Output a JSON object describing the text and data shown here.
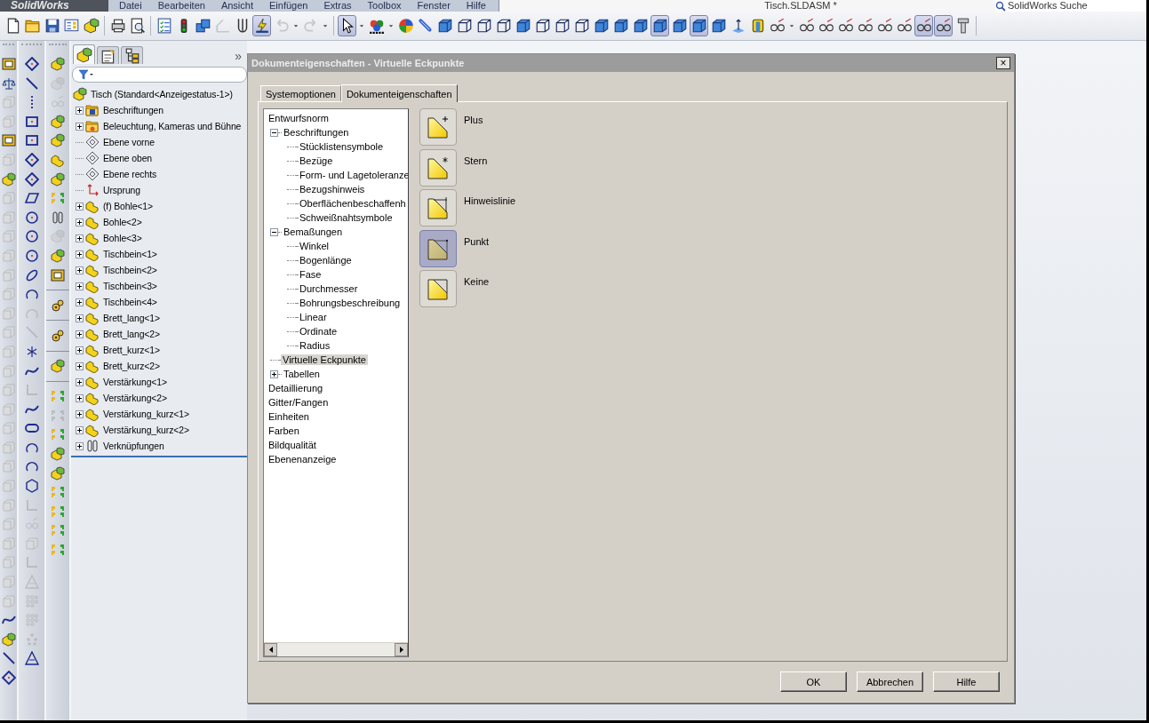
{
  "app": {
    "logo": "SolidWorks",
    "menu": [
      "Datei",
      "Bearbeiten",
      "Ansicht",
      "Einfügen",
      "Extras",
      "Toolbox",
      "Fenster",
      "Hilfe"
    ],
    "document_title": "Tisch.SLDASM *",
    "search": {
      "placeholder": "SolidWorks Suche"
    }
  },
  "toolbar": [
    {
      "kind": "doc",
      "selected": false,
      "disabled": false
    },
    {
      "kind": "folder",
      "selected": false,
      "disabled": false
    },
    {
      "kind": "disk",
      "selected": false,
      "disabled": false
    },
    {
      "kind": "sheet",
      "selected": false,
      "disabled": false
    },
    {
      "kind": "blocks",
      "selected": false,
      "disabled": false
    },
    {
      "kind": "separator"
    },
    {
      "kind": "printer",
      "selected": false,
      "disabled": false
    },
    {
      "kind": "preview",
      "selected": false,
      "disabled": false
    },
    {
      "kind": "separator"
    },
    {
      "kind": "list",
      "selected": false,
      "disabled": false
    },
    {
      "kind": "light",
      "selected": false,
      "disabled": false
    },
    {
      "kind": "cubes",
      "selected": false,
      "disabled": false
    },
    {
      "kind": "sketch",
      "selected": false,
      "disabled": true
    },
    {
      "kind": "pen",
      "selected": false,
      "disabled": false
    },
    {
      "kind": "rebuild",
      "selected": true,
      "disabled": false
    },
    {
      "kind": "undo",
      "selected": false,
      "disabled": true
    },
    {
      "kind": "caret",
      "selected": false,
      "disabled": false
    },
    {
      "kind": "redo",
      "selected": false,
      "disabled": true
    },
    {
      "kind": "caret",
      "selected": false,
      "disabled": false
    },
    {
      "kind": "separator"
    },
    {
      "kind": "arrow",
      "selected": true,
      "disabled": false
    },
    {
      "kind": "caret",
      "selected": false,
      "disabled": false
    },
    {
      "kind": "spheres",
      "selected": false,
      "disabled": false
    },
    {
      "kind": "caret",
      "selected": false,
      "disabled": false
    },
    {
      "kind": "ball",
      "selected": false,
      "disabled": false
    },
    {
      "kind": "pin",
      "selected": false,
      "disabled": false
    },
    {
      "kind": "cube",
      "selected": false,
      "disabled": false
    },
    {
      "kind": "wirecube",
      "selected": false,
      "disabled": false
    },
    {
      "kind": "wirecube",
      "selected": false,
      "disabled": false
    },
    {
      "kind": "wirecube",
      "selected": false,
      "disabled": false
    },
    {
      "kind": "cube",
      "selected": false,
      "disabled": false
    },
    {
      "kind": "wirecube",
      "selected": false,
      "disabled": false
    },
    {
      "kind": "wirecube",
      "selected": false,
      "disabled": false
    },
    {
      "kind": "wirecube",
      "selected": false,
      "disabled": false
    },
    {
      "kind": "cube",
      "selected": false,
      "disabled": false
    },
    {
      "kind": "cube",
      "selected": false,
      "disabled": false
    },
    {
      "kind": "cube",
      "selected": false,
      "disabled": false
    },
    {
      "kind": "cube",
      "selected": true,
      "disabled": false
    },
    {
      "kind": "cube",
      "selected": false,
      "disabled": false
    },
    {
      "kind": "cube",
      "selected": true,
      "disabled": false
    },
    {
      "kind": "cube",
      "selected": false,
      "disabled": false
    },
    {
      "kind": "axis",
      "selected": false,
      "disabled": false
    },
    {
      "kind": "cylinder",
      "selected": false,
      "disabled": false
    },
    {
      "kind": "glasses",
      "selected": false,
      "disabled": false
    },
    {
      "kind": "caret",
      "selected": false,
      "disabled": false
    },
    {
      "kind": "glasses",
      "selected": false,
      "disabled": false
    },
    {
      "kind": "glasses",
      "selected": false,
      "disabled": false
    },
    {
      "kind": "glasses",
      "selected": false,
      "disabled": false
    },
    {
      "kind": "glasses",
      "selected": false,
      "disabled": false
    },
    {
      "kind": "glasses",
      "selected": false,
      "disabled": false
    },
    {
      "kind": "glasses",
      "selected": false,
      "disabled": false
    },
    {
      "kind": "glasses",
      "selected": true,
      "disabled": false
    },
    {
      "kind": "glasses",
      "selected": true,
      "disabled": false
    },
    {
      "kind": "bolt",
      "selected": false,
      "disabled": false
    },
    {
      "kind": "separator"
    }
  ],
  "side_toolbars": [
    [
      {
        "kind": "window",
        "disabled": false
      },
      {
        "kind": "scale",
        "disabled": false
      },
      {
        "kind": "box",
        "disabled": true
      },
      {
        "kind": "box",
        "disabled": true
      },
      {
        "kind": "window",
        "disabled": false
      },
      {
        "kind": "box",
        "disabled": true
      },
      {
        "kind": "blocks",
        "disabled": false
      },
      {
        "kind": "box",
        "disabled": true
      },
      {
        "kind": "box",
        "disabled": true
      },
      {
        "kind": "box",
        "disabled": true
      },
      {
        "kind": "box",
        "disabled": true
      },
      {
        "kind": "box",
        "disabled": true
      },
      {
        "kind": "box",
        "disabled": true
      },
      {
        "kind": "box",
        "disabled": true
      },
      {
        "kind": "box",
        "disabled": true
      },
      {
        "kind": "box",
        "disabled": true
      },
      {
        "kind": "box",
        "disabled": true
      },
      {
        "kind": "box",
        "disabled": true
      },
      {
        "kind": "box",
        "disabled": true
      },
      {
        "kind": "box",
        "disabled": true
      },
      {
        "kind": "box",
        "disabled": true
      },
      {
        "kind": "box",
        "disabled": true
      },
      {
        "kind": "box",
        "disabled": true
      },
      {
        "kind": "box",
        "disabled": true
      },
      {
        "kind": "box",
        "disabled": true
      },
      {
        "kind": "box",
        "disabled": true
      },
      {
        "kind": "box",
        "disabled": true
      },
      {
        "kind": "box",
        "disabled": true
      },
      {
        "kind": "box",
        "disabled": true
      },
      {
        "kind": "curve",
        "disabled": false
      },
      {
        "kind": "blocks",
        "disabled": false
      },
      {
        "kind": "line",
        "disabled": false
      },
      {
        "kind": "diamond",
        "disabled": false
      }
    ],
    [
      {
        "kind": "diamond",
        "disabled": false
      },
      {
        "kind": "line",
        "disabled": false
      },
      {
        "kind": "dotline",
        "disabled": false
      },
      {
        "kind": "rect",
        "disabled": false
      },
      {
        "kind": "rect",
        "disabled": false
      },
      {
        "kind": "diamond",
        "disabled": false
      },
      {
        "kind": "diamond",
        "disabled": false
      },
      {
        "kind": "parallelogram",
        "disabled": false
      },
      {
        "kind": "circle",
        "disabled": false
      },
      {
        "kind": "circle",
        "disabled": false
      },
      {
        "kind": "circle",
        "disabled": false
      },
      {
        "kind": "ellipse",
        "disabled": false
      },
      {
        "kind": "arc",
        "disabled": false
      },
      {
        "kind": "arc",
        "disabled": true
      },
      {
        "kind": "line",
        "disabled": true
      },
      {
        "kind": "point",
        "disabled": false
      },
      {
        "kind": "curve",
        "disabled": false
      },
      {
        "kind": "corner",
        "disabled": true
      },
      {
        "kind": "curve",
        "disabled": false
      },
      {
        "kind": "slot",
        "disabled": false
      },
      {
        "kind": "arc",
        "disabled": false
      },
      {
        "kind": "arc",
        "disabled": false
      },
      {
        "kind": "hexagon",
        "disabled": false
      },
      {
        "kind": "corner",
        "disabled": true
      },
      {
        "kind": "glasses",
        "disabled": true
      },
      {
        "kind": "box",
        "disabled": true
      },
      {
        "kind": "corner",
        "disabled": true
      },
      {
        "kind": "triangle",
        "disabled": true
      },
      {
        "kind": "grid",
        "disabled": true
      },
      {
        "kind": "grid",
        "disabled": true
      },
      {
        "kind": "dots",
        "disabled": true
      },
      {
        "kind": "triangle",
        "disabled": false
      }
    ],
    [
      {
        "kind": "blocks",
        "disabled": false
      },
      {
        "kind": "blocks",
        "disabled": true
      },
      {
        "kind": "glasses",
        "disabled": true
      },
      {
        "kind": "blocks",
        "disabled": false
      },
      {
        "kind": "blocks",
        "disabled": false
      },
      {
        "kind": "part",
        "disabled": false
      },
      {
        "kind": "blocks",
        "disabled": false
      },
      {
        "kind": "mate",
        "disabled": false
      },
      {
        "kind": "clip",
        "disabled": false
      },
      {
        "kind": "blocks",
        "disabled": true
      },
      {
        "kind": "blocks",
        "disabled": false
      },
      {
        "kind": "window",
        "disabled": false
      },
      {
        "kind": "separator"
      },
      {
        "kind": "gear",
        "disabled": false
      },
      {
        "kind": "separator"
      },
      {
        "kind": "gear",
        "disabled": false
      },
      {
        "kind": "separator"
      },
      {
        "kind": "blocks",
        "disabled": false
      },
      {
        "kind": "separator"
      },
      {
        "kind": "mate",
        "disabled": false
      },
      {
        "kind": "mate",
        "disabled": true
      },
      {
        "kind": "mate",
        "disabled": false
      },
      {
        "kind": "blocks",
        "disabled": false
      },
      {
        "kind": "blocks",
        "disabled": false
      },
      {
        "kind": "mate",
        "disabled": false
      },
      {
        "kind": "mate",
        "disabled": false
      },
      {
        "kind": "mate",
        "disabled": false
      },
      {
        "kind": "mate",
        "disabled": false
      }
    ]
  ],
  "feature_manager": {
    "tabs": [
      {
        "kind": "tree",
        "selected": true
      },
      {
        "kind": "properties",
        "selected": false
      },
      {
        "kind": "config",
        "selected": false
      }
    ],
    "more": "»",
    "tree": [
      {
        "label": "Tisch  (Standard<Anzeigestatus-1>)",
        "kind": "blocks",
        "selected": false,
        "children": [
          {
            "label": "Beschriftungen",
            "kind": "folder-a",
            "expanded": false,
            "selected": false
          },
          {
            "label": "Beleuchtung, Kameras und Bühne",
            "kind": "folder-light",
            "expanded": false,
            "selected": false
          },
          {
            "label": "Ebene vorne",
            "kind": "plane",
            "selected": false
          },
          {
            "label": "Ebene oben",
            "kind": "plane",
            "selected": false
          },
          {
            "label": "Ebene rechts",
            "kind": "plane",
            "selected": false
          },
          {
            "label": "Ursprung",
            "kind": "origin",
            "selected": false
          },
          {
            "label": "(f) Bohle<1>",
            "kind": "part",
            "expanded": false,
            "selected": false
          },
          {
            "label": "Bohle<2>",
            "kind": "part",
            "expanded": false,
            "selected": false
          },
          {
            "label": "Bohle<3>",
            "kind": "part",
            "expanded": false,
            "selected": false
          },
          {
            "label": "Tischbein<1>",
            "kind": "part",
            "expanded": false,
            "selected": false
          },
          {
            "label": "Tischbein<2>",
            "kind": "part",
            "expanded": false,
            "selected": false
          },
          {
            "label": "Tischbein<3>",
            "kind": "part",
            "expanded": false,
            "selected": false
          },
          {
            "label": "Tischbein<4>",
            "kind": "part",
            "expanded": false,
            "selected": false
          },
          {
            "label": "Brett_lang<1>",
            "kind": "part",
            "expanded": false,
            "selected": false
          },
          {
            "label": "Brett_lang<2>",
            "kind": "part",
            "expanded": false,
            "selected": false
          },
          {
            "label": "Brett_kurz<1>",
            "kind": "part",
            "expanded": false,
            "selected": false
          },
          {
            "label": "Brett_kurz<2>",
            "kind": "part",
            "expanded": false,
            "selected": false
          },
          {
            "label": "Verstärkung<1>",
            "kind": "part",
            "expanded": false,
            "selected": false
          },
          {
            "label": "Verstärkung<2>",
            "kind": "part",
            "expanded": false,
            "selected": false
          },
          {
            "label": "Verstärkung_kurz<1>",
            "kind": "part",
            "expanded": false,
            "selected": false
          },
          {
            "label": "Verstärkung_kurz<2>",
            "kind": "part",
            "expanded": false,
            "selected": false
          },
          {
            "label": "Verknüpfungen",
            "kind": "clip",
            "expanded": false,
            "selected": false
          }
        ]
      }
    ]
  },
  "dialog": {
    "title": "Dokumenteigenschaften - Virtuelle Eckpunkte",
    "close": "×",
    "tabs": [
      {
        "label": "Systemoptionen",
        "selected": false
      },
      {
        "label": "Dokumenteigenschaften",
        "selected": true
      }
    ],
    "tree": [
      {
        "label": "Entwurfsnorm",
        "selected": false,
        "children": [
          {
            "label": "Beschriftungen",
            "expanded": true,
            "selected": false,
            "children": [
              {
                "label": "Stücklistensymbole",
                "selected": false
              },
              {
                "label": "Bezüge",
                "selected": false
              },
              {
                "label": "Form- und Lagetoleranze",
                "selected": false
              },
              {
                "label": "Bezugshinweis",
                "selected": false
              },
              {
                "label": "Oberflächenbeschaffenh",
                "selected": false
              },
              {
                "label": "Schweißnahtsymbole",
                "selected": false
              }
            ]
          },
          {
            "label": "Bemaßungen",
            "expanded": true,
            "selected": false,
            "children": [
              {
                "label": "Winkel",
                "selected": false
              },
              {
                "label": "Bogenlänge",
                "selected": false
              },
              {
                "label": "Fase",
                "selected": false
              },
              {
                "label": "Durchmesser",
                "selected": false
              },
              {
                "label": "Bohrungsbeschreibung",
                "selected": false
              },
              {
                "label": "Linear",
                "selected": false
              },
              {
                "label": "Ordinate",
                "selected": false
              },
              {
                "label": "Radius",
                "selected": false
              }
            ]
          },
          {
            "label": "Virtuelle Eckpunkte",
            "selected": true
          },
          {
            "label": "Tabellen",
            "expanded": false,
            "selected": false
          }
        ]
      },
      {
        "label": "Detaillierung",
        "selected": false
      },
      {
        "label": "Gitter/Fangen",
        "selected": false
      },
      {
        "label": "Einheiten",
        "selected": false
      },
      {
        "label": "Farben",
        "selected": false
      },
      {
        "label": "Bildqualität",
        "selected": false
      },
      {
        "label": "Ebenenanzeige",
        "selected": false
      }
    ],
    "options": [
      {
        "label": "Plus",
        "kind": "plus",
        "selected": false
      },
      {
        "label": "Stern",
        "kind": "star",
        "selected": false
      },
      {
        "label": "Hinweislinie",
        "kind": "leader",
        "selected": false
      },
      {
        "label": "Punkt",
        "kind": "point",
        "selected": true
      },
      {
        "label": "Keine",
        "kind": "none",
        "selected": false
      }
    ],
    "buttons": [
      "OK",
      "Abbrechen",
      "Hilfe"
    ]
  }
}
